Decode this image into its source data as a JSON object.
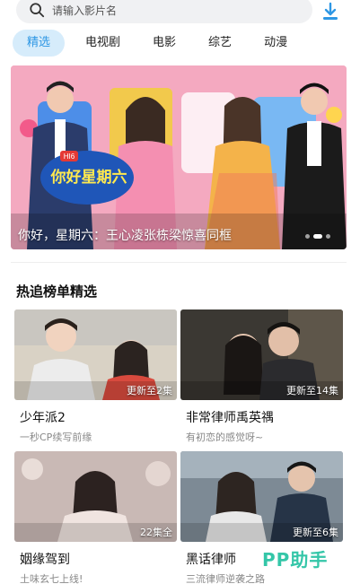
{
  "search": {
    "placeholder": "请输入影片名"
  },
  "tabs": [
    {
      "label": "精选",
      "active": true
    },
    {
      "label": "电视剧",
      "active": false
    },
    {
      "label": "电影",
      "active": false
    },
    {
      "label": "综艺",
      "active": false
    },
    {
      "label": "动漫",
      "active": false
    }
  ],
  "banner": {
    "caption": "你好，星期六：王心凌张栋梁惊喜同框",
    "logo_text": "你好星期六",
    "channel_mark": "HI6"
  },
  "section": {
    "title": "热追榜单精选"
  },
  "cards": [
    {
      "title": "少年派2",
      "subtitle": "一秒CP续写前缘",
      "badge": "更新至2集"
    },
    {
      "title": "非常律师禹英禑",
      "subtitle": "有初恋的感觉呀~",
      "badge": "更新至14集"
    },
    {
      "title": "姻缘驾到",
      "subtitle": "土味玄七上线!",
      "badge": "22集全"
    },
    {
      "title": "黑话律师",
      "subtitle": "三流律师逆袭之路",
      "badge": "更新至6集"
    }
  ],
  "watermark": "PP助手",
  "colors": {
    "accent": "#2e97e4",
    "tab_active_bg": "#d6ecfb",
    "watermark": "#34c6a8"
  },
  "icons": {
    "search": "search-icon",
    "download": "download-icon"
  }
}
